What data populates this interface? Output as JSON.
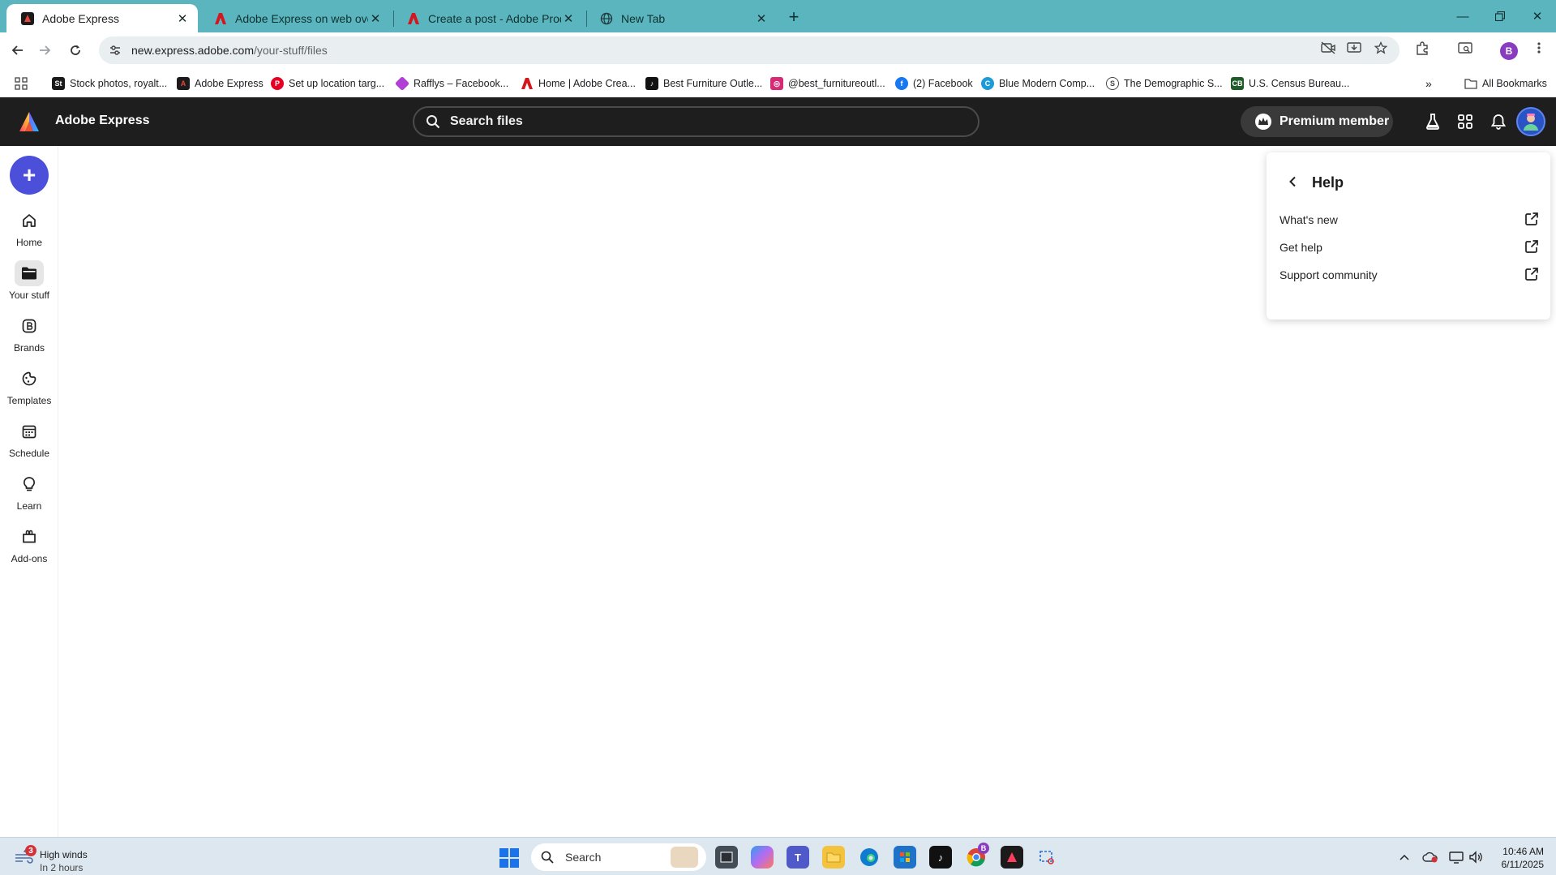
{
  "browser": {
    "tabs": [
      {
        "title": "Adobe Express",
        "active": true
      },
      {
        "title": "Adobe Express on web overvie",
        "active": false
      },
      {
        "title": "Create a post - Adobe Product",
        "active": false
      },
      {
        "title": "New Tab",
        "active": false
      }
    ],
    "url_host": "new.express.adobe.com",
    "url_path": "/your-stuff/files",
    "profile_initial": "B",
    "bookmarks": [
      {
        "label": "Stock photos, royalt..."
      },
      {
        "label": "Adobe Express"
      },
      {
        "label": "Set up location targ..."
      },
      {
        "label": "Rafflys – Facebook..."
      },
      {
        "label": "Home | Adobe Crea..."
      },
      {
        "label": "Best Furniture Outle..."
      },
      {
        "label": "@best_furnitureoutl..."
      },
      {
        "label": "(2) Facebook"
      },
      {
        "label": "Blue Modern Comp..."
      },
      {
        "label": "The Demographic S..."
      },
      {
        "label": "U.S. Census Bureau..."
      }
    ],
    "all_bookmarks_label": "All Bookmarks"
  },
  "app": {
    "name": "Adobe Express",
    "search_placeholder": "Search files",
    "premium_label": "Premium member",
    "brand_color": "#4b4fd9",
    "header_bg": "#1e1e1e"
  },
  "rail": {
    "create_symbol": "+",
    "items": [
      {
        "label": "Home",
        "icon": "home-icon",
        "active": false
      },
      {
        "label": "Your stuff",
        "icon": "folder-icon",
        "active": true
      },
      {
        "label": "Brands",
        "icon": "brand-icon",
        "active": false
      },
      {
        "label": "Templates",
        "icon": "templates-icon",
        "active": false
      },
      {
        "label": "Schedule",
        "icon": "calendar-icon",
        "active": false
      },
      {
        "label": "Learn",
        "icon": "lightbulb-icon",
        "active": false
      },
      {
        "label": "Add-ons",
        "icon": "addons-icon",
        "active": false
      }
    ]
  },
  "help": {
    "title": "Help",
    "items": [
      {
        "label": "What's new",
        "icon": "external-link-icon"
      },
      {
        "label": "Get help",
        "icon": "external-link-icon"
      },
      {
        "label": "Support community",
        "icon": "external-link-icon"
      }
    ]
  },
  "taskbar": {
    "weather_title": "High winds",
    "weather_sub": "In 2 hours",
    "weather_badge": "3",
    "search_label": "Search",
    "chrome_badge": "B",
    "time": "10:46 AM",
    "date": "6/11/2025"
  }
}
